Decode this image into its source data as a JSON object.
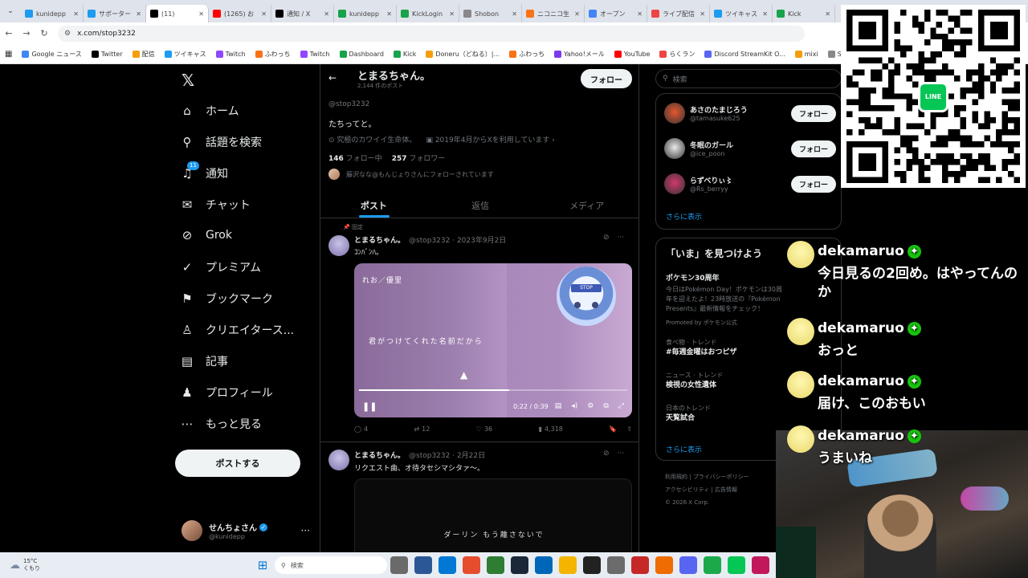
{
  "browser": {
    "tabs": [
      {
        "label": "kunidepp",
        "color": "#1d9bf0",
        "icon": "twitcasting-icon"
      },
      {
        "label": "サポーター",
        "color": "#1d9bf0",
        "icon": "twitcasting-icon"
      },
      {
        "label": "(11)",
        "color": "#000000",
        "icon": "x-icon",
        "active": true
      },
      {
        "label": "(1265) お",
        "color": "#ff0000",
        "icon": "youtube-icon"
      },
      {
        "label": "通知 / X",
        "color": "#000000",
        "icon": "x-icon"
      },
      {
        "label": "kunidepp",
        "color": "#16a34a",
        "icon": "kick-icon"
      },
      {
        "label": "KickLogin",
        "color": "#16a34a",
        "icon": "kick-icon"
      },
      {
        "label": "Shobon",
        "color": "#888888",
        "icon": "shobon-icon"
      },
      {
        "label": "ニコニコ生",
        "color": "#f97316",
        "icon": "niconico-icon"
      },
      {
        "label": "オープン",
        "color": "#4285f4",
        "icon": "google-icon"
      },
      {
        "label": "ライブ配信",
        "color": "#ef4444",
        "icon": "live-icon"
      },
      {
        "label": "ツイキャス",
        "color": "#1d9bf0",
        "icon": "twitcasting-icon"
      },
      {
        "label": "Kick",
        "color": "#16a34a",
        "icon": "kick-icon"
      }
    ],
    "url": "x.com/stop3232",
    "bookmarks": [
      {
        "label": "Google ニュース",
        "color": "#4285f4"
      },
      {
        "label": "Twitter",
        "color": "#000000"
      },
      {
        "label": "配信",
        "color": "#f59e0b"
      },
      {
        "label": "ツイキャス",
        "color": "#1d9bf0"
      },
      {
        "label": "Twitch",
        "color": "#9146ff"
      },
      {
        "label": "ふわっち",
        "color": "#f97316"
      },
      {
        "label": "Twitch",
        "color": "#9146ff"
      },
      {
        "label": "Dashboard",
        "color": "#16a34a"
      },
      {
        "label": "Kick",
        "color": "#16a34a"
      },
      {
        "label": "Doneru（どねる）|...",
        "color": "#f59e0b"
      },
      {
        "label": "ふわっち",
        "color": "#f97316"
      },
      {
        "label": "Yahoo!メール",
        "color": "#7c3aed"
      },
      {
        "label": "YouTube",
        "color": "#ff0000"
      },
      {
        "label": "らくラン",
        "color": "#ef4444"
      },
      {
        "label": "Discord StreamKit O...",
        "color": "#5865f2"
      },
      {
        "label": "mixi",
        "color": "#f59e0b"
      },
      {
        "label": "Shobon Kick Ra",
        "color": "#888888"
      }
    ]
  },
  "nav": {
    "items": [
      {
        "label": "ホーム",
        "icon": "home-icon"
      },
      {
        "label": "話題を検索",
        "icon": "search-icon"
      },
      {
        "label": "通知",
        "icon": "bell-icon",
        "badge": "11"
      },
      {
        "label": "チャット",
        "icon": "mail-icon"
      },
      {
        "label": "Grok",
        "icon": "grok-icon"
      },
      {
        "label": "プレミアム",
        "icon": "premium-icon"
      },
      {
        "label": "ブックマーク",
        "icon": "bookmark-icon"
      },
      {
        "label": "クリエイタース...",
        "icon": "creator-icon"
      },
      {
        "label": "記事",
        "icon": "article-icon"
      },
      {
        "label": "プロフィール",
        "icon": "person-icon"
      },
      {
        "label": "もっと見る",
        "icon": "more-icon"
      }
    ],
    "post_button": "ポストする",
    "account": {
      "name": "せんちょさん",
      "handle": "@kunidepp"
    }
  },
  "profile": {
    "header_name": "とまるちゃん。",
    "post_count": "2,144 件のポスト",
    "follow_button": "フォロー",
    "handle": "@stop3232",
    "bio": "たちってと。",
    "category": "究極のカワイイ生命体。",
    "joined": "2019年4月からXを利用しています",
    "following_count": "146",
    "following_label": "フォロー中",
    "followers_count": "257",
    "followers_label": "フォロワー",
    "followed_by": "藤沢なな@もんじょりさんにフォローされています",
    "tabs": [
      "ポスト",
      "返信",
      "メディア"
    ]
  },
  "tweets": [
    {
      "pinned_label": "固定",
      "name": "とまるちゃん。",
      "meta": "@stop3232 · 2023年9月2日",
      "text": "ｺﾝﾊﾞﾝﾊ。",
      "video": {
        "caption_top": "れお／優里",
        "caption_mid": "君がつけてくれた名前だから",
        "time": "0:22 / 0:39",
        "progress": 0.56
      },
      "stats": {
        "replies": "4",
        "reposts": "12",
        "likes": "36",
        "views": "4,318"
      }
    },
    {
      "name": "とまるちゃん。",
      "meta": "@stop3232 · 2月22日",
      "text": "リクエスト曲、オ待タセシマシタァ〜。",
      "video": {
        "caption_mid": "ダーリン もう離さないで"
      }
    }
  ],
  "right": {
    "search_placeholder": "検索",
    "suggestions": [
      {
        "name": "あさのたまじろう",
        "handle": "@tamasuke625",
        "button": "フォロー",
        "color": "#e4572e"
      },
      {
        "name": "冬眠のガール",
        "handle": "@ice_poon",
        "button": "フォロー",
        "color": "#e8e8e8"
      },
      {
        "name": "らずべりぃ〻",
        "handle": "@Rs_berryy",
        "button": "フォロー",
        "color": "#d2386c"
      }
    ],
    "show_more": "さらに表示",
    "trends_title": "「いま」を見つけよう",
    "promo": {
      "title": "ポケモン30周年",
      "text": "今日はPokémon Day！ポケモンは30周年を迎えたよ！23時放送の『Pokémon Presents』最新情報をチェック！",
      "by": "Promoted by ポケモン公式"
    },
    "trends": [
      {
        "category": "食べ物 · トレンド",
        "title": "#毎週金曜はおつピザ"
      },
      {
        "category": "ニュース · トレンド",
        "title": "検視の女性遺体"
      },
      {
        "category": "日本のトレンド",
        "title": "天覧試合"
      }
    ],
    "show_more_2": "さらに表示",
    "footer": [
      "利用規約",
      "プライバシーポリシー",
      "アクセシビリティ",
      "広告情報",
      "© 2026 X Corp."
    ]
  },
  "chat": {
    "messages": [
      {
        "name": "dekamaruo",
        "text": "今日見るの2回め。はやってんのか"
      },
      {
        "name": "dekamaruo",
        "text": "おっと"
      },
      {
        "name": "dekamaruo",
        "text": "届け、このおもい"
      },
      {
        "name": "dekamaruo",
        "text": "うまいね"
      }
    ]
  },
  "qr": {
    "badge": "LINE"
  },
  "taskbar": {
    "weather_temp": "15°C",
    "weather_desc": "くもり",
    "search_label": "検索"
  }
}
